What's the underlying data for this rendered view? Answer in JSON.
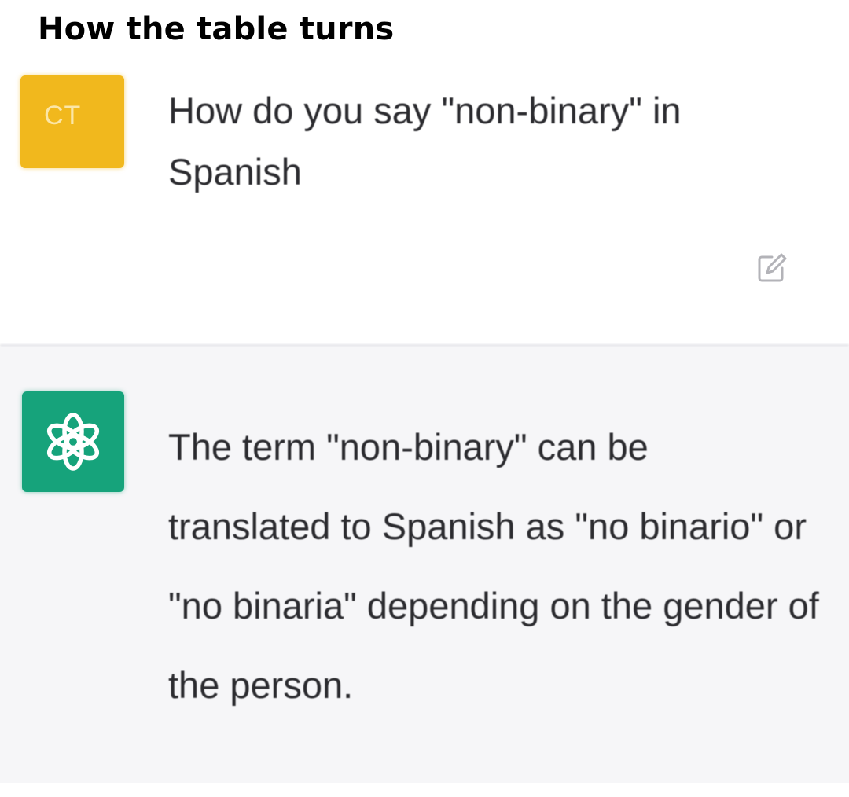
{
  "caption": "How the table turns",
  "user_message": {
    "avatar_initials": "CT",
    "avatar_color": "#f1b81d",
    "text": "How do you say \"non-binary\" in Spanish",
    "edit_icon": "edit-icon"
  },
  "assistant_message": {
    "avatar_icon": "openai-logo-icon",
    "avatar_color": "#16a37b",
    "text": "The term \"non-binary\" can be translated to Spanish as \"no binario\" or \"no binaria\" depending on the gender of the person."
  }
}
